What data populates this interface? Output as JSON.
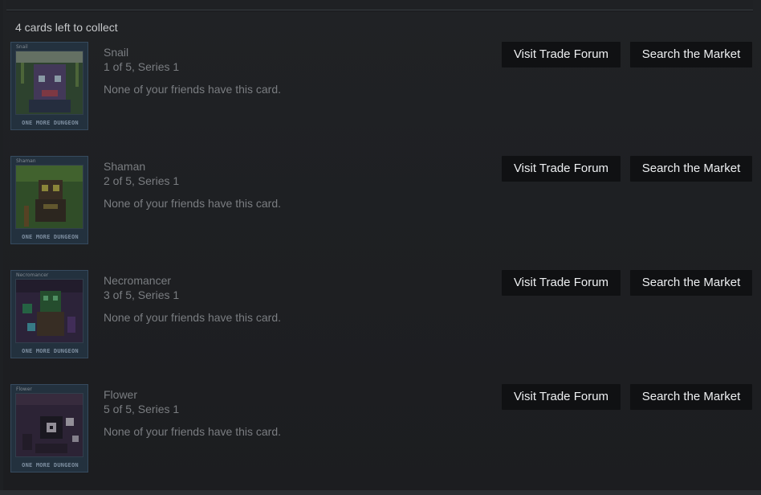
{
  "summary": "4 cards left to collect",
  "buttons": {
    "trade": "Visit Trade Forum",
    "market": "Search the Market"
  },
  "game_logo": "ONE MORE DUNGEON",
  "cards": [
    {
      "name": "Snail",
      "thumb_label": "Snail",
      "series": "1 of 5, Series 1",
      "friends": "None of your friends have this card.",
      "art_bg": "#3b5a3a",
      "art_fg": "#5b4a7a",
      "art_accent": "#b54b5a"
    },
    {
      "name": "Shaman",
      "thumb_label": "Shaman",
      "series": "2 of 5, Series 1",
      "friends": "None of your friends have this card.",
      "art_bg": "#3f6a30",
      "art_fg": "#4a3a28",
      "art_accent": "#c9c04a"
    },
    {
      "name": "Necromancer",
      "thumb_label": "Necromancer",
      "series": "3 of 5, Series 1",
      "friends": "None of your friends have this card.",
      "art_bg": "#3a2a4a",
      "art_fg": "#2f6a3a",
      "art_accent": "#6fd08a"
    },
    {
      "name": "Flower",
      "thumb_label": "Flower",
      "series": "5 of 5, Series 1",
      "friends": "None of your friends have this card.",
      "art_bg": "#3a2a44",
      "art_fg": "#1e1a24",
      "art_accent": "#d8d0dc"
    }
  ]
}
